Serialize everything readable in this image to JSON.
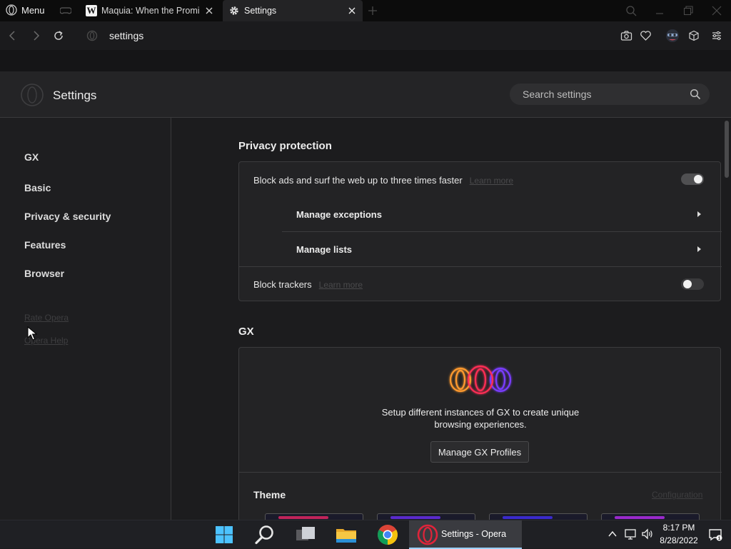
{
  "browser": {
    "menu_label": "Menu",
    "tabs": [
      {
        "title": "Maquia: When the Promised Flower Blooms",
        "favicon": "W",
        "active": false
      },
      {
        "title": "Settings",
        "favicon": "gear-icon",
        "active": true
      }
    ],
    "address": "settings"
  },
  "settings": {
    "title": "Settings",
    "search_placeholder": "Search settings"
  },
  "sidebar": {
    "items": [
      {
        "label": "GX"
      },
      {
        "label": "Basic"
      },
      {
        "label": "Privacy & security"
      },
      {
        "label": "Features"
      },
      {
        "label": "Browser"
      }
    ],
    "links": [
      {
        "label": "Rate Opera"
      },
      {
        "label": "Opera Help"
      }
    ]
  },
  "privacy": {
    "title": "Privacy protection",
    "block_ads": {
      "label": "Block ads and surf the web up to three times faster",
      "learn_more": "Learn more",
      "enabled": true
    },
    "manage_exceptions": "Manage exceptions",
    "manage_lists": "Manage lists",
    "block_trackers": {
      "label": "Block trackers",
      "learn_more": "Learn more",
      "enabled": false
    }
  },
  "gx": {
    "title": "GX",
    "profiles_text_line1": "Setup different instances of GX to create unique",
    "profiles_text_line2": "browsing experiences.",
    "manage_profiles_button": "Manage GX Profiles",
    "theme_title": "Theme",
    "theme_link": "Configuration"
  },
  "taskbar": {
    "active_app_label": "Settings - Opera",
    "time": "8:17 PM",
    "date": "8/28/2022"
  },
  "colors": {
    "background": "#1c1c1e",
    "card": "#232325",
    "taskbar": "#1f2024",
    "accent_opera": "#e0243a"
  }
}
